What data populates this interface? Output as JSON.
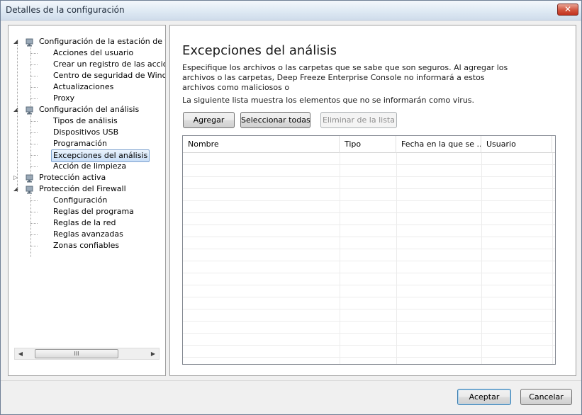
{
  "window": {
    "title": "Detalles de la configuración",
    "close_glyph": "✕"
  },
  "tree": {
    "items": [
      {
        "label": "Configuración de la estación de trat",
        "level": 0,
        "expanded": true,
        "icon": "workstation-lock-icon"
      },
      {
        "label": "Acciones del usuario",
        "level": 1
      },
      {
        "label": "Crear un registro de las accione",
        "level": 1
      },
      {
        "label": "Centro de seguridad de Window",
        "level": 1
      },
      {
        "label": "Actualizaciones",
        "level": 1
      },
      {
        "label": "Proxy",
        "level": 1
      },
      {
        "label": "Configuración del análisis",
        "level": 0,
        "expanded": true,
        "icon": "scan-settings-icon"
      },
      {
        "label": "Tipos de análisis",
        "level": 1
      },
      {
        "label": "Dispositivos USB",
        "level": 1
      },
      {
        "label": "Programación",
        "level": 1
      },
      {
        "label": "Excepciones del análisis",
        "level": 1,
        "selected": true
      },
      {
        "label": "Acción de limpieza",
        "level": 1
      },
      {
        "label": "Protección activa",
        "level": 0,
        "expanded": false,
        "icon": "active-protection-icon"
      },
      {
        "label": "Protección del Firewall",
        "level": 0,
        "expanded": true,
        "icon": "firewall-icon"
      },
      {
        "label": "Configuración",
        "level": 1
      },
      {
        "label": "Reglas del  programa",
        "level": 1
      },
      {
        "label": "Reglas de la red",
        "level": 1
      },
      {
        "label": "Reglas avanzadas",
        "level": 1
      },
      {
        "label": "Zonas confiables",
        "level": 1
      }
    ],
    "scroll_grip": "III"
  },
  "content": {
    "title": "Excepciones del análisis",
    "description": "Especifique los archivos o las carpetas que se sabe que son seguros. Al agregar los archivos o las carpetas, Deep Freeze Enterprise Console no informará a estos archivos como maliciosos o",
    "info": "La siguiente lista muestra los elementos que no se informarán como virus.",
    "buttons": {
      "add": "Agregar",
      "select_all": "Seleccionar todas",
      "remove": "Eliminar de la lista"
    },
    "list": {
      "columns": [
        "Nombre",
        "Tipo",
        "Fecha en la que se ...",
        "Usuario"
      ],
      "rows": []
    }
  },
  "footer": {
    "ok": "Aceptar",
    "cancel": "Cancelar"
  },
  "colors": {
    "title_bar": "#dde8f3",
    "close_button": "#c0321f",
    "selection": "#c8def7",
    "panel_border": "#a0a0a0"
  }
}
